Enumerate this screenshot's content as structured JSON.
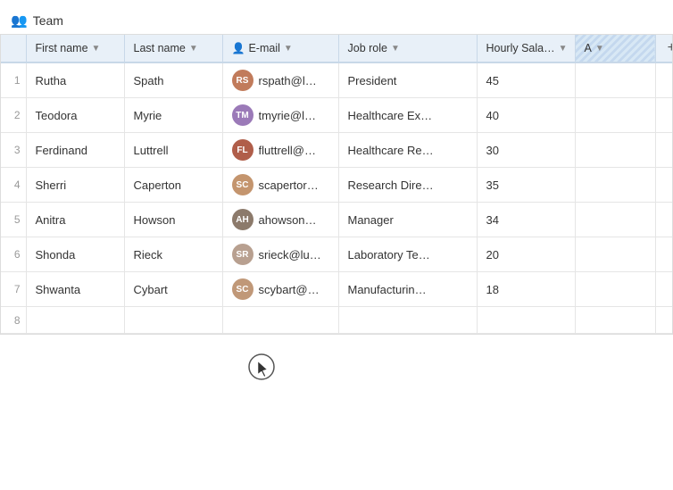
{
  "title": {
    "icon": "👥",
    "label": "Team"
  },
  "columns": [
    {
      "id": "num",
      "label": "",
      "cls": "col-num"
    },
    {
      "id": "first",
      "label": "First name",
      "cls": "col-first",
      "sortable": true
    },
    {
      "id": "last",
      "label": "Last name",
      "cls": "col-last",
      "sortable": true
    },
    {
      "id": "email",
      "label": "E-mail",
      "cls": "col-email",
      "sortable": true,
      "hasIcon": true
    },
    {
      "id": "role",
      "label": "Job role",
      "cls": "col-role",
      "sortable": true
    },
    {
      "id": "salary",
      "label": "Hourly Sala…",
      "cls": "col-salary",
      "sortable": true
    },
    {
      "id": "a",
      "label": "A",
      "cls": "col-a th-striped",
      "sortable": false
    },
    {
      "id": "add",
      "label": "+",
      "cls": "col-add th-add"
    }
  ],
  "rows": [
    {
      "num": 1,
      "first": "Rutha",
      "last": "Spath",
      "email": "rspath@l…",
      "role": "President",
      "salary": "45",
      "avatarColor": "#c17b5b",
      "avatarInitials": "RS"
    },
    {
      "num": 2,
      "first": "Teodora",
      "last": "Myrie",
      "email": "tmyrie@l…",
      "role": "Healthcare Ex…",
      "salary": "40",
      "avatarColor": "#9b7ab8",
      "avatarInitials": "TM"
    },
    {
      "num": 3,
      "first": "Ferdinand",
      "last": "Luttrell",
      "email": "fluttrell@…",
      "role": "Healthcare Re…",
      "salary": "30",
      "avatarColor": "#b05e4a",
      "avatarInitials": "FL"
    },
    {
      "num": 4,
      "first": "Sherri",
      "last": "Caperton",
      "email": "scapertor…",
      "role": "Research Dire…",
      "salary": "35",
      "avatarColor": "#c4956e",
      "avatarInitials": "SC"
    },
    {
      "num": 5,
      "first": "Anitra",
      "last": "Howson",
      "email": "ahowson…",
      "role": "Manager",
      "salary": "34",
      "avatarColor": "#8c7a6b",
      "avatarInitials": "AH"
    },
    {
      "num": 6,
      "first": "Shonda",
      "last": "Rieck",
      "email": "srieck@lu…",
      "role": "Laboratory Te…",
      "salary": "20",
      "avatarColor": "#b8a090",
      "avatarInitials": "SR"
    },
    {
      "num": 7,
      "first": "Shwanta",
      "last": "Cybart",
      "email": "scybart@…",
      "role": "Manufacturin…",
      "salary": "18",
      "avatarColor": "#c09878",
      "avatarInitials": "SC"
    }
  ],
  "add_button_label": "+"
}
